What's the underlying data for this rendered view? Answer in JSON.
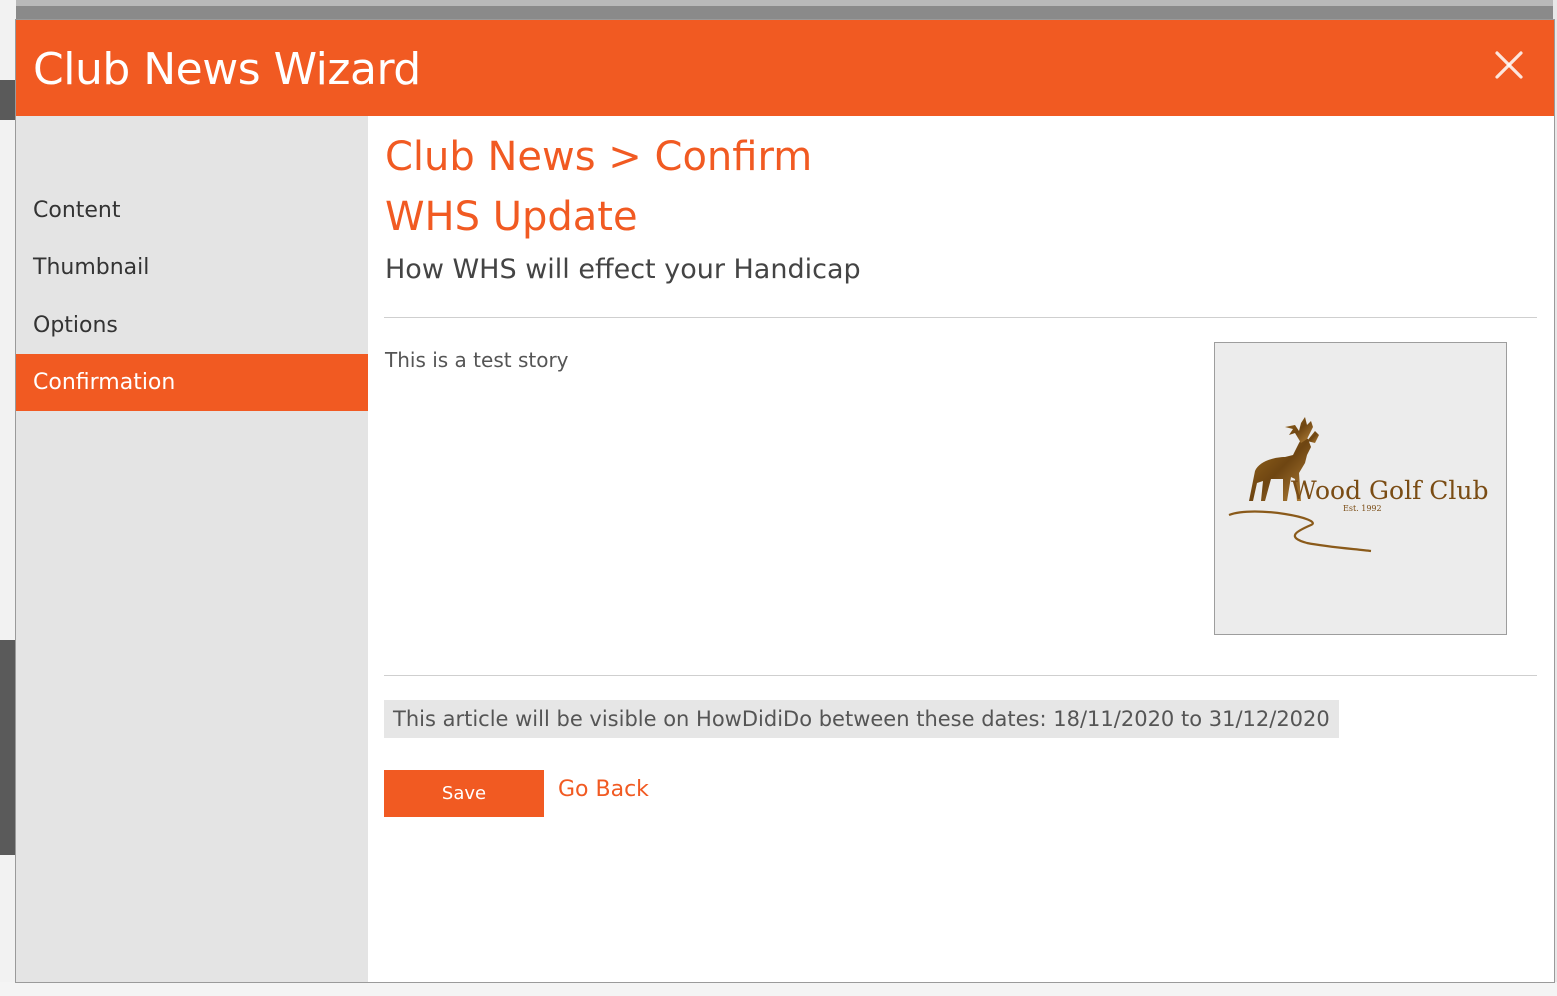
{
  "wizard": {
    "title": "Club News Wizard",
    "close_icon": "close-icon",
    "accent_color": "#f15a22"
  },
  "sidebar": {
    "items": [
      {
        "label": "Content",
        "active": false
      },
      {
        "label": "Thumbnail",
        "active": false
      },
      {
        "label": "Options",
        "active": false
      },
      {
        "label": "Confirmation",
        "active": true
      }
    ]
  },
  "main": {
    "breadcrumb": "Club News > Confirm",
    "article_title": "WHS Update",
    "article_subtitle": "How WHS will effect your Handicap",
    "story_text": "This is a test story",
    "thumbnail": {
      "logo_name": "Wood Golf Club",
      "logo_established": "Est. 1992"
    },
    "visibility_text": "This article will be visible on HowDidiDo between these dates: 18/11/2020 to 31/12/2020",
    "save_label": "Save",
    "go_back_label": "Go Back"
  }
}
